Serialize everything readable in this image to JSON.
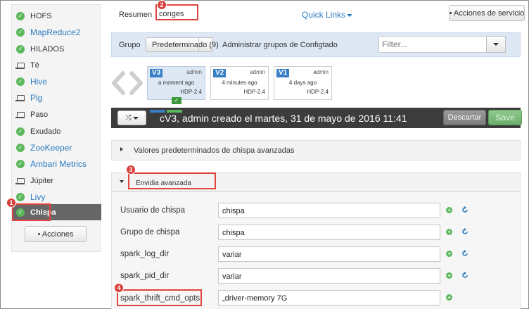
{
  "sidebar": {
    "services": [
      {
        "label": "HOFS",
        "icon": "check-circle-icon",
        "link": false
      },
      {
        "label": "MapReduce2",
        "icon": "check-circle-icon",
        "link": true
      },
      {
        "label": "HILADOS",
        "icon": "check-circle-icon",
        "link": false
      },
      {
        "label": "Té",
        "icon": "laptop-icon",
        "link": false
      },
      {
        "label": "Hive",
        "icon": "check-circle-icon",
        "link": true
      },
      {
        "label": "Pig",
        "icon": "laptop-icon",
        "link": true
      },
      {
        "label": "Paso",
        "icon": "laptop-icon",
        "link": false
      },
      {
        "label": "Exudado",
        "icon": "check-circle-icon",
        "link": false
      },
      {
        "label": "ZooKeeper",
        "icon": "check-circle-icon",
        "link": true
      },
      {
        "label": "Ambari Metrics",
        "icon": "check-circle-icon",
        "link": true
      },
      {
        "label": "Júpiter",
        "icon": "laptop-icon",
        "link": false
      },
      {
        "label": "Livy",
        "icon": "check-circle-icon",
        "link": true
      },
      {
        "label": "Chispa",
        "icon": "check-circle-icon",
        "link": false,
        "active": true
      }
    ],
    "actions_label": "• Acciones"
  },
  "header": {
    "tabs": [
      "Resumen",
      "conges"
    ],
    "quick_links": "Quick Links",
    "service_actions": "• Acciones de servicio"
  },
  "group_bar": {
    "label": "Grupo",
    "selected": "Predeterminado (9)",
    "manage": "Administrar grupos de Configtado",
    "filter_placeholder": "Filter..."
  },
  "versions": [
    {
      "tag": "V3",
      "author": "admin",
      "time": "a moment ago",
      "stack": "HDP-2.4",
      "current": true
    },
    {
      "tag": "V2",
      "author": "admin",
      "time": "4 minutes ago",
      "stack": "HDP-2.4",
      "current": false
    },
    {
      "tag": "V1",
      "author": "admin",
      "time": "4 days ago",
      "stack": "HDP-2.4",
      "current": false
    }
  ],
  "version_bar": {
    "description": "cV3, admin creado el martes, 31 de mayo de 2016 11:41",
    "discard": "Descartar",
    "save": "Save"
  },
  "sections": {
    "defaults_title": "Valores predeterminados de chispa avanzadas",
    "advanced_title": "Envidia avanzada"
  },
  "properties": [
    {
      "label": "Usuario de chispa",
      "value": "chispa",
      "reset": true
    },
    {
      "label": "Grupo de chispa",
      "value": "chispa",
      "reset": true
    },
    {
      "label": "spark_log_dir",
      "value": "variar",
      "reset": true
    },
    {
      "label": "spark_pid_dir",
      "value": "variar",
      "reset": true
    },
    {
      "label": "spark_thrift_cmd_opts",
      "value": "„driver-memory 7G",
      "reset": false
    }
  ],
  "callouts": [
    "1",
    "2",
    "3",
    "4"
  ],
  "colors": {
    "link": "#2a7bbf",
    "version_tag": "#3a7fc4",
    "success": "#5cb85c",
    "highlight": "#e0443e",
    "dark_bar": "#3c3c3c"
  }
}
